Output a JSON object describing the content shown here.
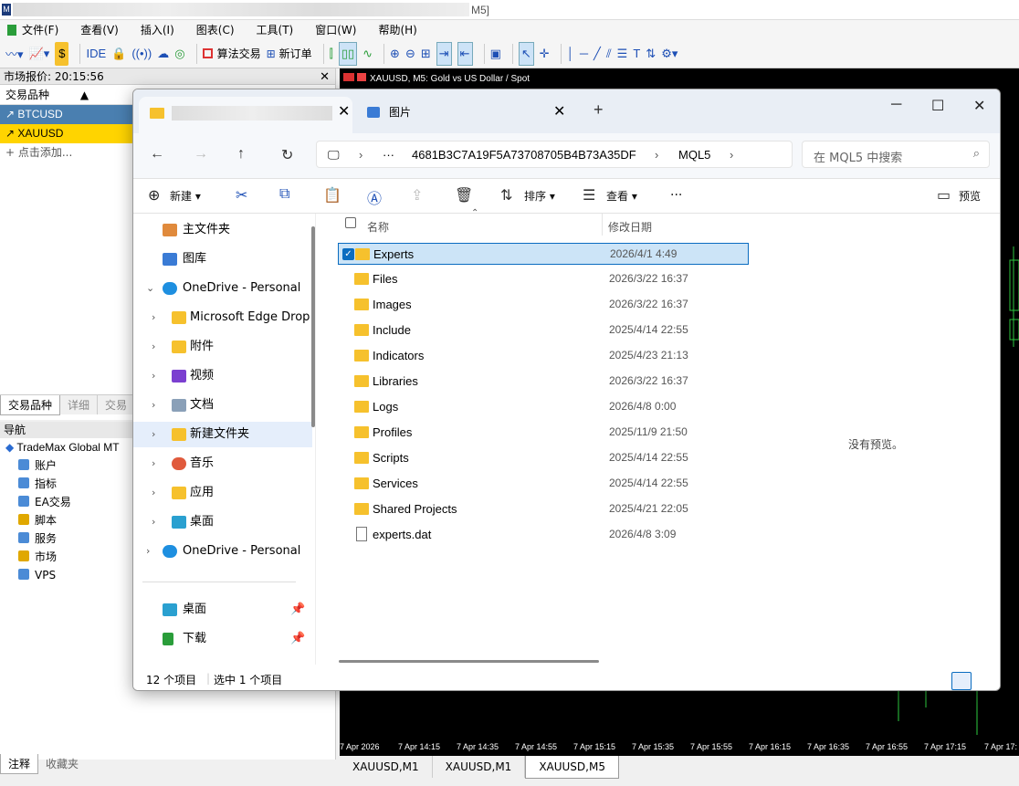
{
  "window": {
    "title_suffix": "M5]"
  },
  "menu": [
    "文件(F)",
    "查看(V)",
    "插入(I)",
    "图表(C)",
    "工具(T)",
    "窗口(W)",
    "帮助(H)"
  ],
  "toolbar": {
    "ide": "IDE",
    "algo": "算法交易",
    "new_order": "新订单"
  },
  "market_watch": {
    "title": "市场报价: 20:15:56",
    "col_symbol": "交易品种",
    "rows": [
      "BTCUSD",
      "XAUUSD"
    ],
    "add": "+ 点击添加...",
    "tabs": [
      "交易品种",
      "详细",
      "交易"
    ]
  },
  "navigator": {
    "title": "导航",
    "root": "TradeMax Global MT",
    "items": [
      "账户",
      "指标",
      "EA交易",
      "脚本",
      "服务",
      "市场",
      "VPS"
    ],
    "tabs": [
      "注释",
      "收藏夹"
    ]
  },
  "chart": {
    "title": "XAUUSD, M5:  Gold vs US Dollar / Spot",
    "time_labels": [
      "7 Apr 2026",
      "7 Apr 14:15",
      "7 Apr 14:35",
      "7 Apr 14:55",
      "7 Apr 15:15",
      "7 Apr 15:35",
      "7 Apr 15:55",
      "7 Apr 16:15",
      "7 Apr 16:35",
      "7 Apr 16:55",
      "7 Apr 17:15",
      "7 Apr 17:"
    ],
    "tabs": [
      "XAUUSD,M1",
      "XAUUSD,M1",
      "XAUUSD,M5"
    ]
  },
  "explorer": {
    "tab2_label": "图片",
    "path": [
      "4681B3C7A19F5A73708705B4B73A35DF",
      "MQL5"
    ],
    "search_placeholder": "在 MQL5 中搜索",
    "commands": {
      "new": "新建",
      "sort": "排序",
      "view": "查看",
      "more": "···",
      "preview": "预览"
    },
    "nav": [
      {
        "label": "主文件夹",
        "icon": "home-icon"
      },
      {
        "label": "图库",
        "icon": "gallery-icon"
      },
      {
        "label": "OneDrive - Personal",
        "icon": "cloud-icon"
      },
      {
        "label": "Microsoft Edge Drop",
        "icon": "folder-icon"
      },
      {
        "label": "附件",
        "icon": "folder-icon"
      },
      {
        "label": "视频",
        "icon": "video-icon"
      },
      {
        "label": "文档",
        "icon": "document-icon"
      },
      {
        "label": "新建文件夹",
        "icon": "folder-icon"
      },
      {
        "label": "音乐",
        "icon": "music-icon"
      },
      {
        "label": "应用",
        "icon": "folder-icon"
      },
      {
        "label": "桌面",
        "icon": "desktop-icon"
      },
      {
        "label": "OneDrive - Personal",
        "icon": "cloud-icon"
      },
      {
        "label": "桌面",
        "icon": "desktop-icon"
      },
      {
        "label": "下载",
        "icon": "download-icon"
      }
    ],
    "columns": {
      "name": "名称",
      "date": "修改日期"
    },
    "files": [
      {
        "name": "Experts",
        "date": "2026/4/1 4:49",
        "type": "folder"
      },
      {
        "name": "Files",
        "date": "2026/3/22 16:37",
        "type": "folder"
      },
      {
        "name": "Images",
        "date": "2026/3/22 16:37",
        "type": "folder"
      },
      {
        "name": "Include",
        "date": "2025/4/14 22:55",
        "type": "folder"
      },
      {
        "name": "Indicators",
        "date": "2025/4/23 21:13",
        "type": "folder"
      },
      {
        "name": "Libraries",
        "date": "2026/3/22 16:37",
        "type": "folder"
      },
      {
        "name": "Logs",
        "date": "2026/4/8 0:00",
        "type": "folder"
      },
      {
        "name": "Profiles",
        "date": "2025/11/9 21:50",
        "type": "folder"
      },
      {
        "name": "Scripts",
        "date": "2025/4/14 22:55",
        "type": "folder"
      },
      {
        "name": "Services",
        "date": "2025/4/14 22:55",
        "type": "folder"
      },
      {
        "name": "Shared Projects",
        "date": "2025/4/21 22:05",
        "type": "folder"
      },
      {
        "name": "experts.dat",
        "date": "2026/4/8 3:09",
        "type": "file"
      }
    ],
    "preview_text": "没有预览。",
    "status": {
      "count": "12 个项目",
      "selected": "选中 1 个项目"
    }
  }
}
